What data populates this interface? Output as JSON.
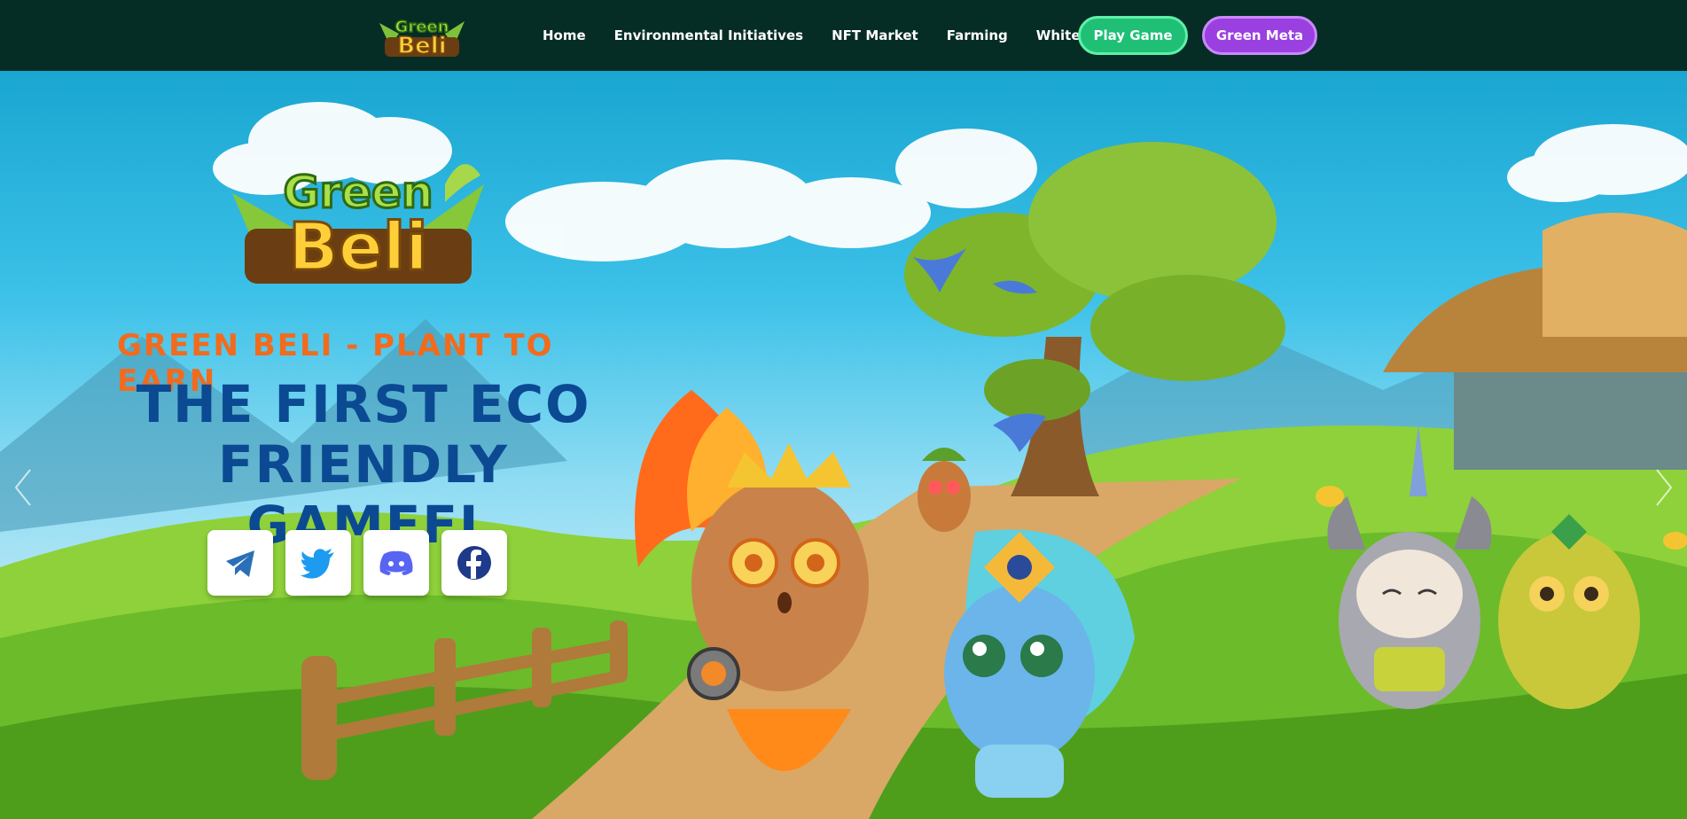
{
  "nav": {
    "logo_text_top": "Green",
    "logo_text_bottom": "Beli",
    "links": [
      {
        "label": "Home"
      },
      {
        "label": "Environmental Initiatives"
      },
      {
        "label": "NFT Market"
      },
      {
        "label": "Farming"
      },
      {
        "label": "Whitepaper"
      }
    ],
    "play_button": "Play Game",
    "meta_button": "Green Meta"
  },
  "hero": {
    "logo_text_top": "Green",
    "logo_text_bottom": "Beli",
    "tagline": "GREEN BELI - PLANT TO EARN",
    "heading_line1": "THE FIRST ECO",
    "heading_line2": "FRIENDLY GAMEFI",
    "socials": [
      {
        "icon": "telegram-icon"
      },
      {
        "icon": "twitter-icon"
      },
      {
        "icon": "discord-icon"
      },
      {
        "icon": "facebook-icon"
      }
    ]
  },
  "colors": {
    "nav_bg": "#062d25",
    "play_button": "#1fbf76",
    "meta_button": "#9a3fe0",
    "tagline": "#f26b1d",
    "heading": "#0b4a93"
  }
}
